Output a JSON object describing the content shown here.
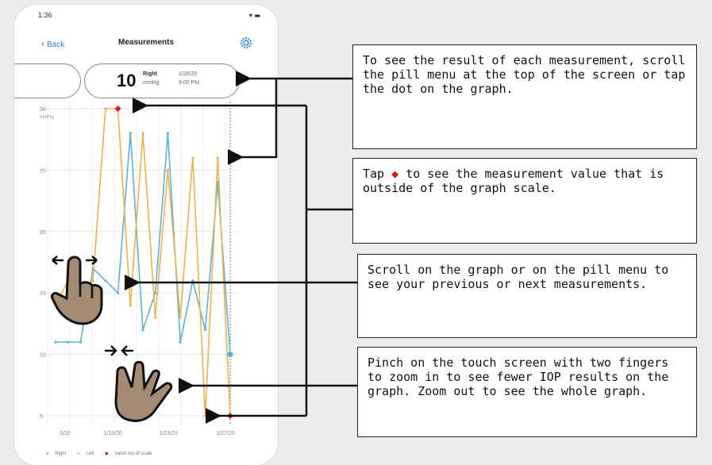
{
  "status_bar": {
    "time": "1:36",
    "icons": "▾ ▬"
  },
  "nav": {
    "back_label": "Back",
    "title": "Measurements"
  },
  "pill": {
    "value": "10",
    "eye": "Right",
    "unit": "mmHg",
    "date": "1/26/20",
    "time": "9:00 PM"
  },
  "chart_data": {
    "type": "line",
    "y_axis": {
      "ticks": [
        30,
        25,
        20,
        15,
        10,
        5
      ],
      "unit": "mmHg",
      "range": [
        5,
        30
      ]
    },
    "x_axis": {
      "ticks": [
        "5/20",
        "1/19/20",
        "1/23/20",
        "1/27/20"
      ]
    },
    "series": [
      {
        "name": "Right",
        "color": "#5bb3d6",
        "values": [
          11,
          11,
          11,
          17,
          16,
          15,
          28,
          12,
          15,
          28,
          11,
          16,
          12,
          24,
          10
        ]
      },
      {
        "name": "Left",
        "color": "#f0b04a",
        "values": [
          14,
          16,
          15,
          16,
          30,
          30,
          14,
          28,
          13,
          25,
          13,
          26,
          5,
          26,
          5
        ]
      }
    ],
    "out_of_scale_points": [
      {
        "index": 5,
        "value": 30
      },
      {
        "index": 14,
        "value": 5
      }
    ],
    "legend": [
      "Right",
      "Left",
      "Value out of scale"
    ],
    "grid": true
  },
  "callouts": [
    {
      "text": "To see the result of each measurement, scroll the pill menu at the top of the screen or tap the dot on the graph."
    },
    {
      "text_before": "Tap",
      "icon": "◆",
      "text_after": "to see the measurement value that is outside of the graph scale."
    },
    {
      "text": "Scroll on the graph or on the pill menu to see your previous or next measurements."
    },
    {
      "text": "Pinch on the touch screen with two fingers to zoom in to see fewer IOP results on the graph. Zoom out to see the whole graph."
    }
  ],
  "colors": {
    "accent": "#2f7fd0",
    "out_of_scale": "#d01d1d",
    "hand": "#a38b74"
  }
}
